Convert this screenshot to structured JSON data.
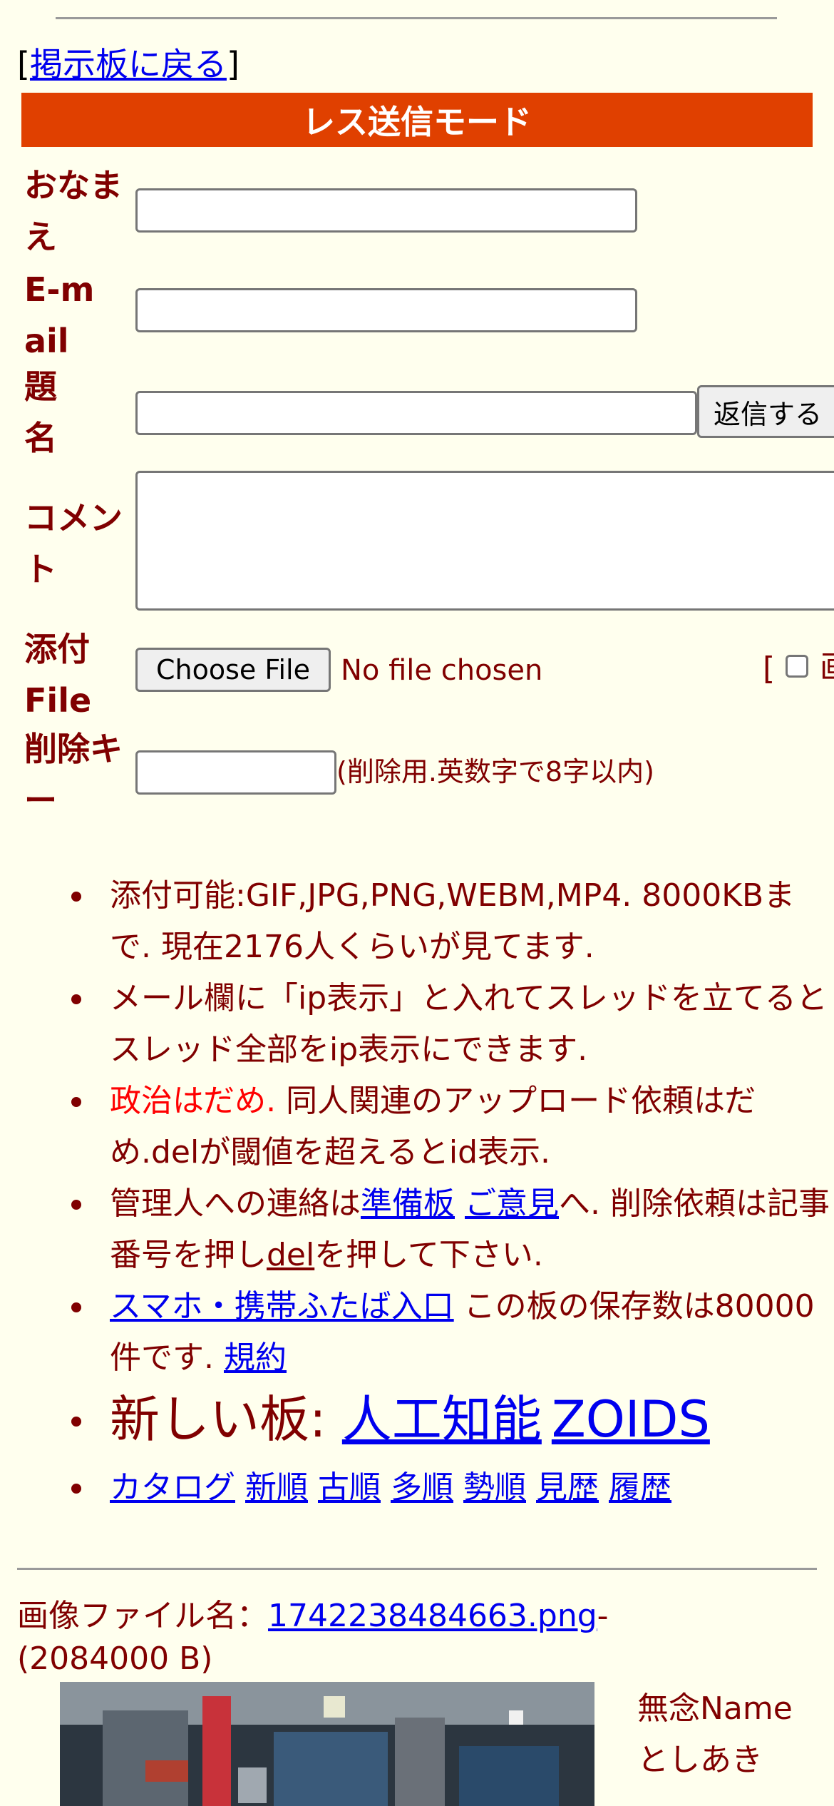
{
  "nav": {
    "back_open": "[",
    "back_link": "掲示板に戻る",
    "back_close": "]"
  },
  "mode_bar": {
    "title": "レス送信モード",
    "color": "#e04000"
  },
  "form": {
    "name_label": "おなまえ",
    "email_label": "E-mail",
    "subject_label": "題名",
    "submit_label": "返信する",
    "comment_label": "コメント",
    "file_label": "添付File",
    "choose_file_label": "Choose File",
    "no_file_text": "No file chosen",
    "image_option_bracket": "[",
    "image_option_glyph": "画",
    "delete_key_label": "削除キー",
    "delete_key_note": "(削除用.英数字で8字以内)"
  },
  "notes": {
    "n1_text": "添付可能:GIF,JPG,PNG,WEBM,MP4. 8000KBまで. 現在2176人くらいが見てます.",
    "n2_text": "メール欄に「ip表示」と入れてスレッドを立てるとスレッド全部をip表示にできます.",
    "n3_red": "政治はだめ.",
    "n3_text": " 同人関連のアップロード依頼はだめ.delが閾値を超えるとid表示.",
    "n4_a": "管理人への連絡は",
    "n4_link1": "準備板",
    "n4_space": " ",
    "n4_link2": "ご意見",
    "n4_b": "へ. 削除依頼は記事番号を押し",
    "n4_link3": "del",
    "n4_c": "を押して下さい.",
    "n5_link1": "スマホ・携帯ふたば入口",
    "n5_text": " この板の保存数は80000件です. ",
    "n5_link2": "規約",
    "n6_text": "新しい板: ",
    "n6_link1": "人工知能",
    "n6_link2": "ZOIDS",
    "n7_links": [
      "カタログ",
      "新順",
      "古順",
      "多順",
      "勢順",
      "見歴",
      "履歴"
    ]
  },
  "post": {
    "file_prefix": "画像ファイル名：",
    "file_link": "1742238484663.png",
    "file_dash": "-",
    "file_size": "(2084000 B)",
    "name_line": "無念Name",
    "name_value": "としあき"
  }
}
